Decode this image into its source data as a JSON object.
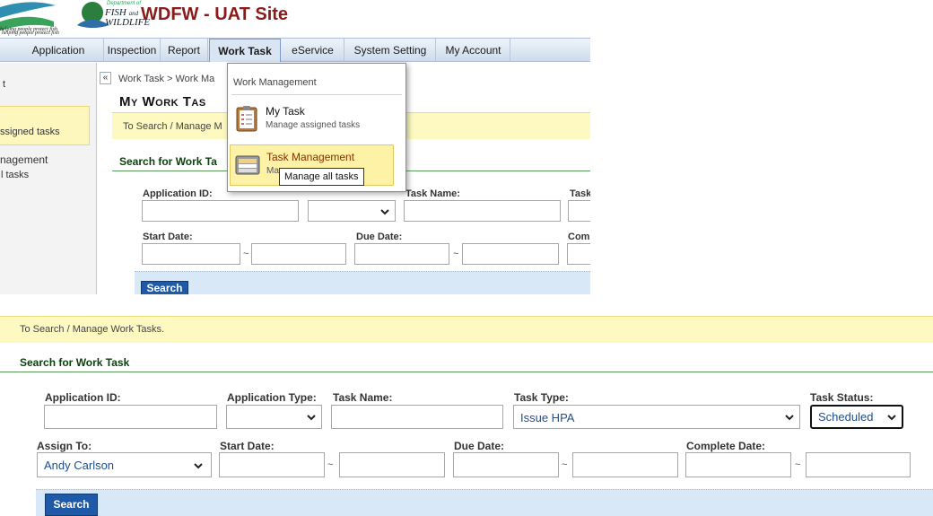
{
  "header": {
    "agency_line1": "Department of",
    "agency_name_a": "FISH",
    "agency_name_b": "and",
    "agency_name_c": "WILDLIFE",
    "tagline": "helping people protect fish",
    "site_title": "WDFW - UAT Site"
  },
  "nav": {
    "tabs": [
      {
        "label": "Application"
      },
      {
        "label": "Inspection"
      },
      {
        "label": "Report"
      },
      {
        "label": "Work Task"
      },
      {
        "label": "eService"
      },
      {
        "label": "System Setting"
      },
      {
        "label": "My Account"
      }
    ]
  },
  "sidebar": {
    "frag1": "t",
    "frag2": "ssigned tasks",
    "frag3": "nagement",
    "frag4": "l tasks"
  },
  "menu": {
    "header": "Work Management",
    "items": [
      {
        "title": "My Task",
        "subtitle": "Manage assigned tasks",
        "icon": "clipboard-icon"
      },
      {
        "title": "Task Management",
        "subtitle": "Ma",
        "icon": "tray-icon"
      }
    ],
    "tooltip": "Manage all tasks"
  },
  "top": {
    "collapse": "«",
    "breadcrumb": "Work Task > Work Ma",
    "page_title": "My Work Tas",
    "info": "To Search / Manage M",
    "section": "Search for Work Ta",
    "labels": {
      "app_id": "Application ID:",
      "task_name": "Task Name:",
      "task": "Task",
      "start_date": "Start Date:",
      "due_date": "Due Date:",
      "comp": "Comp"
    },
    "tilde": "~",
    "search_label": "Search"
  },
  "bottom": {
    "info": "To Search / Manage Work Tasks.",
    "section": "Search for Work Task",
    "labels": {
      "app_id": "Application ID:",
      "app_type": "Application Type:",
      "task_name": "Task Name:",
      "task_type": "Task Type:",
      "task_status": "Task Status:",
      "assign_to": "Assign To:",
      "start_date": "Start Date:",
      "due_date": "Due Date:",
      "complete_date": "Complete Date:"
    },
    "values": {
      "task_type": "Issue HPA",
      "task_status": "Scheduled",
      "assign_to": "Andy Carlson"
    },
    "tilde": "~",
    "search_label": "Search"
  },
  "colors": {
    "site_title": "#8b1a1a",
    "section_heading": "#0b3f0b",
    "info_bar": "#fdf9c0",
    "search_button": "#1e5aa8",
    "menu_highlight": "#fdf2a6"
  }
}
